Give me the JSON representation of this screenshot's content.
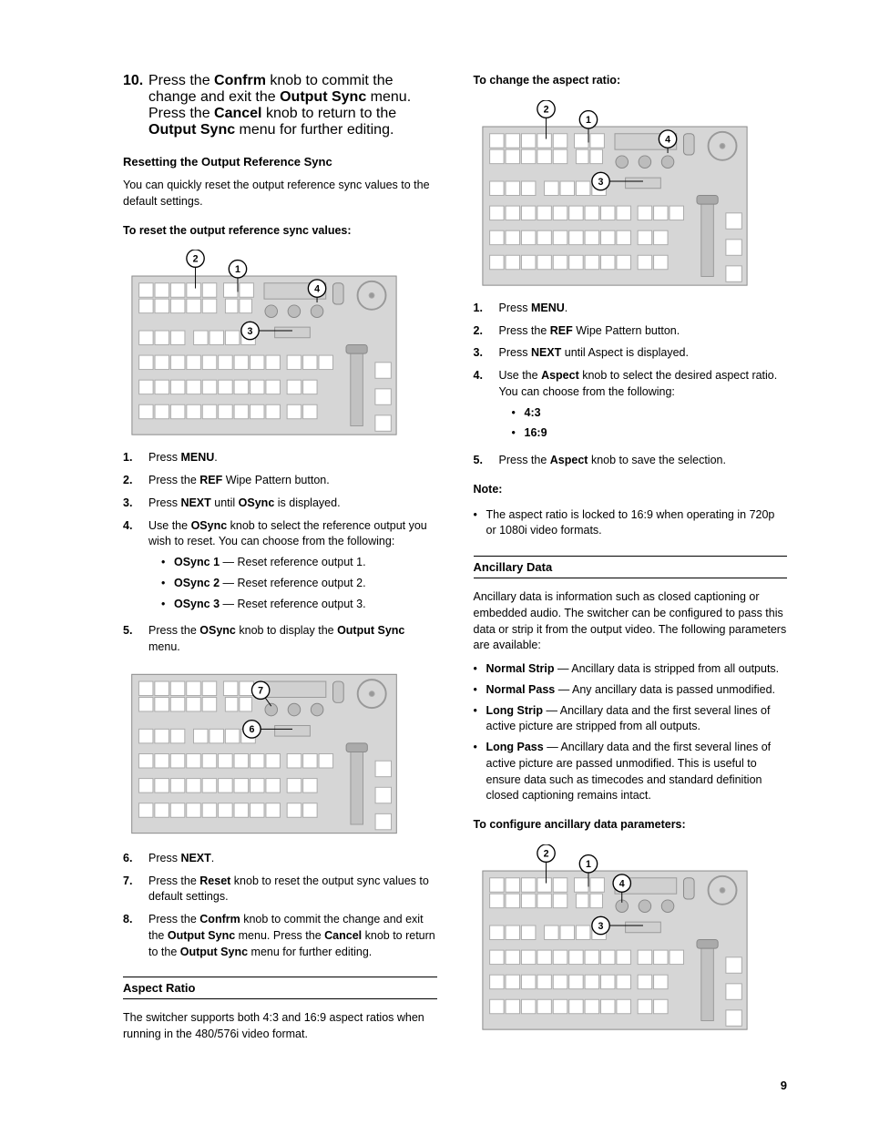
{
  "pagenum": "9",
  "left": {
    "step10": "Press the <b>Confrm</b> knob to commit the change and exit the <b>Output Sync</b> menu. Press the <b>Cancel</b> knob to return to the <b>Output Sync</b> menu for further editing.",
    "reset_head": "Resetting the Output Reference Sync",
    "reset_intro": "You can quickly reset the output reference sync values to the default settings.",
    "reset_to": "To reset the output reference sync values:",
    "reset_steps_a": [
      "Press <b>MENU</b>.",
      "Press the <b>REF</b> Wipe Pattern button.",
      "Press <b>NEXT</b> until <b>OSync</b> is displayed."
    ],
    "reset_step4": "Use the <b>OSync</b> knob to select the reference output you wish to reset. You can choose from the following:",
    "reset_step4_opts": [
      "<b>OSync 1</b> — Reset reference output 1.",
      "<b>OSync 2</b> — Reset reference output 2.",
      "<b>OSync 3</b> — Reset reference output 3."
    ],
    "reset_step5": "Press the <b>OSync</b> knob to display the <b>Output Sync</b> menu.",
    "reset_steps_b": [
      "Press <b>NEXT</b>.",
      "Press the <b>Reset</b> knob to reset the output sync values to default settings.",
      "Press the <b>Confrm</b> knob to commit the change and exit the <b>Output Sync</b> menu. Press the <b>Cancel</b> knob to return to the <b>Output Sync</b> menu for further editing."
    ],
    "aspect_head": "Aspect Ratio",
    "aspect_intro": "The switcher supports both 4:3 and 16:9 aspect ratios when running in the 480/576i video format."
  },
  "right": {
    "change_head": "To change the aspect ratio:",
    "change_steps123": [
      "Press <b>MENU</b>.",
      "Press the <b>REF</b> Wipe Pattern button.",
      "Press <b>NEXT</b> until Aspect is displayed."
    ],
    "change_step4": "Use the <b>Aspect</b> knob to select the desired aspect ratio. You can choose from the following:",
    "change_step4_opts": [
      "<b>4:3</b>",
      "<b>16:9</b>"
    ],
    "change_step5": "Press the <b>Aspect</b> knob to save the selection.",
    "note_head": "Note:",
    "note_items": [
      "The aspect ratio is locked to 16:9 when operating in 720p or 1080i video formats."
    ],
    "anc_head": "Ancillary Data",
    "anc_intro": "Ancillary data is information such as closed captioning or embedded audio. The switcher can be configured to pass this data or strip it from the output video. The following parameters are available:",
    "anc_params": [
      "<b>Normal Strip</b> — Ancillary data is stripped from all outputs.",
      "<b>Normal Pass</b> — Any ancillary data is passed unmodified.",
      "<b>Long Strip</b> — Ancillary data and the first several lines of active picture are stripped from all outputs.",
      "<b>Long Pass</b> — Ancillary data and the first several lines of active picture are passed unmodified. This is useful to ensure data such as timecodes and standard definition closed captioning remains intact."
    ],
    "anc_to": "To configure ancillary data parameters:"
  },
  "panel": {
    "c1": "1",
    "c2": "2",
    "c3": "3",
    "c4": "4",
    "c6": "6",
    "c7": "7"
  }
}
